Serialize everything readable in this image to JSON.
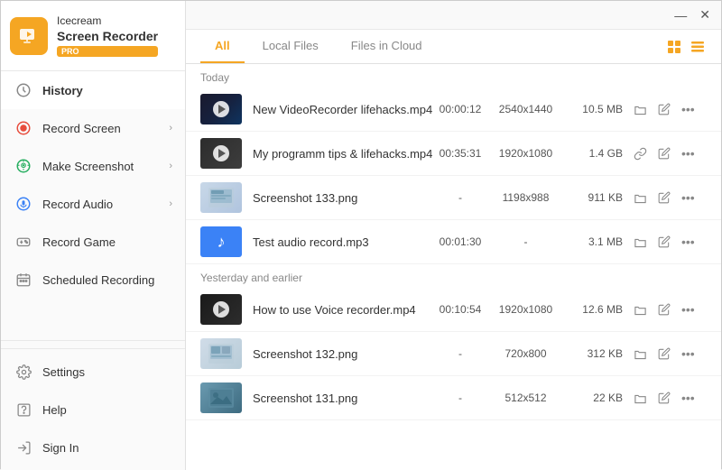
{
  "app": {
    "title_line1": "Icecream",
    "title_line2": "Screen Recorder",
    "pro_badge": "PRO"
  },
  "titlebar": {
    "minimize": "—",
    "close": "✕"
  },
  "sidebar": {
    "items": [
      {
        "id": "history",
        "label": "History",
        "icon": "clock",
        "active": true,
        "arrow": false
      },
      {
        "id": "record-screen",
        "label": "Record Screen",
        "icon": "record-screen",
        "active": false,
        "arrow": true
      },
      {
        "id": "make-screenshot",
        "label": "Make Screenshot",
        "icon": "screenshot",
        "active": false,
        "arrow": true
      },
      {
        "id": "record-audio",
        "label": "Record Audio",
        "icon": "mic",
        "active": false,
        "arrow": true
      },
      {
        "id": "record-game",
        "label": "Record Game",
        "icon": "game",
        "active": false,
        "arrow": false
      },
      {
        "id": "scheduled-recording",
        "label": "Scheduled Recording",
        "icon": "calendar",
        "active": false,
        "arrow": false
      }
    ],
    "bottom": [
      {
        "id": "settings",
        "label": "Settings",
        "icon": "gear"
      },
      {
        "id": "help",
        "label": "Help",
        "icon": "help"
      },
      {
        "id": "sign-in",
        "label": "Sign In",
        "icon": "signin"
      }
    ]
  },
  "tabs": [
    {
      "id": "all",
      "label": "All",
      "active": true
    },
    {
      "id": "local-files",
      "label": "Local Files",
      "active": false
    },
    {
      "id": "files-in-cloud",
      "label": "Files in Cloud",
      "active": false
    }
  ],
  "sections": [
    {
      "label": "Today",
      "files": [
        {
          "id": 1,
          "name": "New VideoRecorder lifehacks.mp4",
          "type": "video",
          "duration": "00:00:12",
          "resolution": "2540x1440",
          "size": "10.5 MB"
        },
        {
          "id": 2,
          "name": "My programm tips & lifehacks.mp4",
          "type": "video",
          "duration": "00:35:31",
          "resolution": "1920x1080",
          "size": "1.4 GB"
        },
        {
          "id": 3,
          "name": "Screenshot 133.png",
          "type": "screenshot",
          "duration": "-",
          "resolution": "1198x988",
          "size": "911 KB"
        },
        {
          "id": 4,
          "name": "Test audio record.mp3",
          "type": "audio",
          "duration": "00:01:30",
          "resolution": "-",
          "size": "3.1 MB"
        }
      ]
    },
    {
      "label": "Yesterday and earlier",
      "files": [
        {
          "id": 5,
          "name": "How to use Voice recorder.mp4",
          "type": "video",
          "duration": "00:10:54",
          "resolution": "1920x1080",
          "size": "12.6 MB"
        },
        {
          "id": 6,
          "name": "Screenshot 132.png",
          "type": "screenshot",
          "duration": "-",
          "resolution": "720x800",
          "size": "312 KB"
        },
        {
          "id": 7,
          "name": "Screenshot 131.png",
          "type": "screenshot",
          "duration": "-",
          "resolution": "512x512",
          "size": "22 KB"
        }
      ]
    }
  ],
  "colors": {
    "accent": "#f5a623",
    "active_tab_border": "#f5a623"
  }
}
